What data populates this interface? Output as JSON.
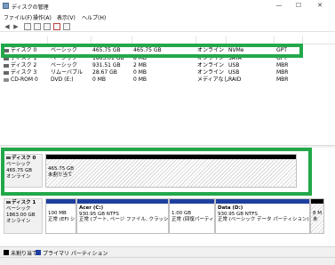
{
  "window": {
    "title": "ディスクの管理",
    "minimize_glyph": "—",
    "maximize_glyph": "☐",
    "close_glyph": "✕"
  },
  "menu": [
    "ファイル(F)",
    "操作(A)",
    "表示(V)",
    "ヘルプ(H)"
  ],
  "toolbar": {
    "back_glyph": "◀",
    "forward_glyph": "▶",
    "icons": [
      "list-view-icon",
      "help-icon",
      "properties-icon",
      "check-icon",
      "disk-view-icon"
    ]
  },
  "volume_list": {
    "columns": [
      "",
      "",
      "",
      "",
      "",
      "",
      ""
    ],
    "rows": [
      {
        "disk": "ディスク 0",
        "type": "ベーシック",
        "capacity": "465.75 GB",
        "unalloc": "465.75 GB",
        "status": "オンライン",
        "device": "NVMe",
        "partition_style": "GPT"
      },
      {
        "disk": "ディスク 1",
        "type": "ベーシック",
        "capacity": "1863.01 GB",
        "unalloc": "8 MB",
        "status": "オンライン",
        "device": "SATA",
        "partition_style": "GPT"
      },
      {
        "disk": "ディスク 2",
        "type": "ベーシック",
        "capacity": "931.51 GB",
        "unalloc": "2 MB",
        "status": "オンライン",
        "device": "USB",
        "partition_style": "MBR"
      },
      {
        "disk": "ディスク 3",
        "type": "リムーバブル",
        "capacity": "28.67 GB",
        "unalloc": "0 MB",
        "status": "オンライン",
        "device": "USB",
        "partition_style": "MBR"
      },
      {
        "disk": "CD-ROM 0",
        "type": "DVD (E:)",
        "capacity": "0 MB",
        "unalloc": "0 MB",
        "status": "メディアなし",
        "device": "RAID",
        "partition_style": "MBR"
      }
    ]
  },
  "disks": [
    {
      "name": "ディスク 0",
      "type": "ベーシック",
      "size": "465.75 GB",
      "status": "オンライン",
      "partitions": [
        {
          "size": "465.75 GB",
          "label": "未割り当て",
          "kind": "unallocated"
        }
      ]
    },
    {
      "name": "ディスク 1",
      "type": "ベーシック",
      "size": "1863.00 GB",
      "status": "オンライン",
      "partitions": [
        {
          "title": "",
          "size": "100 MB",
          "status": "正常 (EFI シ",
          "kind": "primary"
        },
        {
          "title": "Acer (C:)",
          "size": "930.95 GB NTFS",
          "status": "正常 (ブート, ページ ファイル, クラッシュ ダ",
          "kind": "primary"
        },
        {
          "title": "",
          "size": "1.00 GB",
          "status": "正常 (回復パーティ",
          "kind": "primary"
        },
        {
          "title": "Data (D:)",
          "size": "930.95 GB NTFS",
          "status": "正常 (ベーシック データ パーティション)",
          "kind": "primary"
        },
        {
          "title": "",
          "size": "8 M",
          "status": "未",
          "kind": "unallocated"
        }
      ]
    }
  ],
  "legend": [
    {
      "label": "未割り当て",
      "color": "#000000"
    },
    {
      "label": "プライマリ パーティション",
      "color": "#1f3fa0"
    }
  ],
  "colors": {
    "highlight": "#22a84a",
    "partition_bar": "#1f3fa0",
    "unallocated_bar": "#000000"
  }
}
